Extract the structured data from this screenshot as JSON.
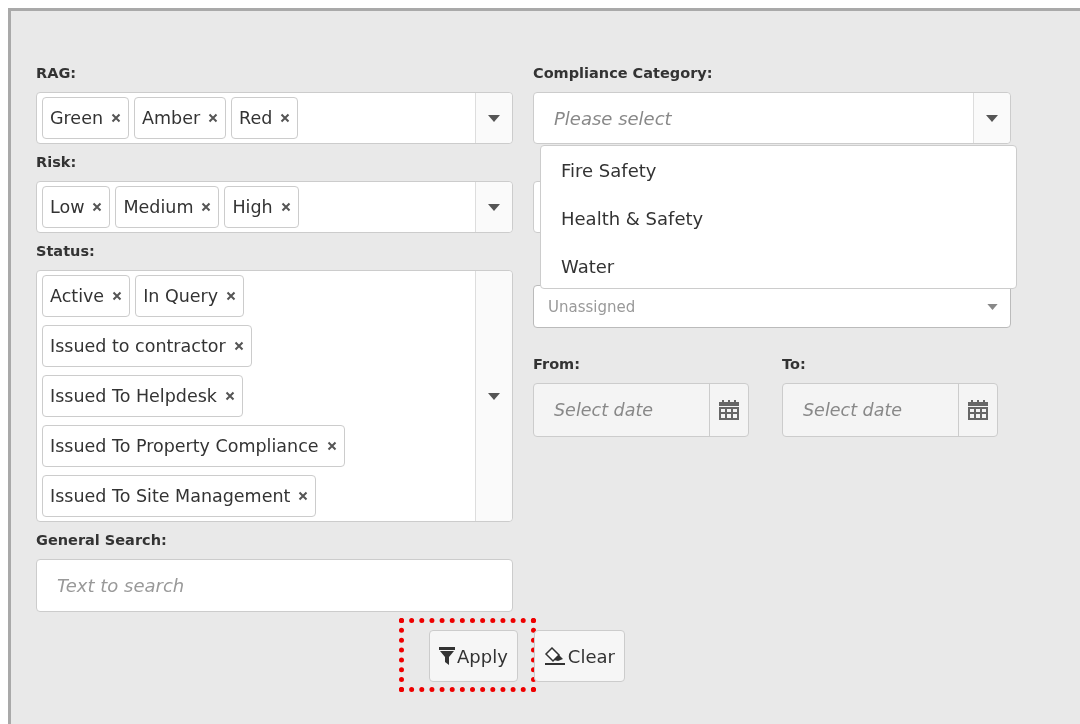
{
  "left": [
    {
      "kind": "multiselect",
      "label": "RAG:",
      "tags": [
        "Green",
        "Amber",
        "Red"
      ]
    },
    {
      "kind": "multiselect",
      "label": "Risk:",
      "tags": [
        "Low",
        "Medium",
        "High"
      ]
    },
    {
      "kind": "multiselect",
      "label": "Status:",
      "tags": [
        "Active",
        "In Query",
        "Issued to contractor",
        "Issued To Helpdesk",
        "Issued To Property Compliance",
        "Issued To Site Management"
      ]
    },
    {
      "kind": "search",
      "label": "General Search:",
      "placeholder": "Text to search"
    }
  ],
  "right": [
    {
      "kind": "select",
      "label": "Compliance Category:",
      "placeholder": "Please select"
    },
    {
      "kind": "covered"
    },
    {
      "kind": "small-select",
      "value": "Unassigned"
    },
    {
      "kind": "dates",
      "fields": [
        {
          "label": "From:",
          "placeholder": "Select date"
        },
        {
          "label": "To:",
          "placeholder": "Select date"
        }
      ]
    }
  ],
  "dropdown": {
    "options": [
      "Fire Safety",
      "Health & Safety",
      "Water"
    ]
  },
  "buttons": [
    {
      "label": "Apply",
      "kind": "apply",
      "highlighted": true
    },
    {
      "label": "Clear",
      "kind": "clear",
      "highlighted": false
    }
  ]
}
